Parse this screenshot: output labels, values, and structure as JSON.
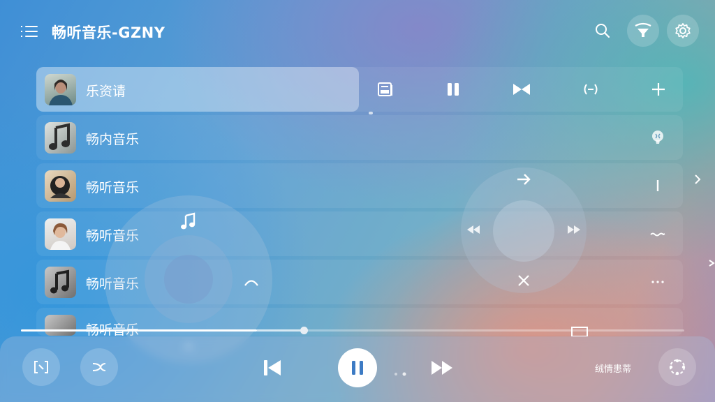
{
  "header": {
    "title": "畅听音乐-GZNY"
  },
  "list": [
    {
      "label": "乐资请"
    },
    {
      "label": "畅内音乐"
    },
    {
      "label": "畅听音乐"
    },
    {
      "label": "畅听音乐"
    },
    {
      "label": "畅听音乐"
    },
    {
      "label": "畅听音乐"
    }
  ],
  "player": {
    "progress": 0.36,
    "right_label": "绒情患蒂"
  },
  "icons": {
    "menu": "menu-icon",
    "search": "search-icon",
    "filter": "filter-icon",
    "settings": "gear-icon"
  },
  "colors": {
    "play_button": "#ffffff",
    "accent_icon": "#3d7bc4"
  }
}
